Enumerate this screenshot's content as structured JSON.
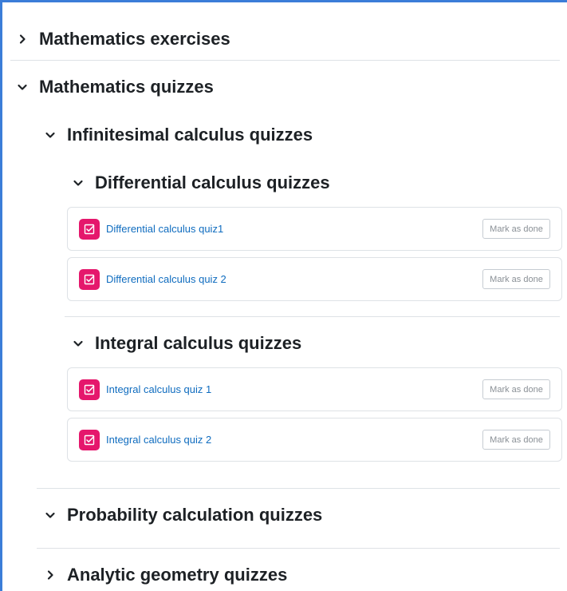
{
  "sections": {
    "math_exercises": {
      "title": "Mathematics exercises",
      "expanded": false
    },
    "math_quizzes": {
      "title": "Mathematics quizzes",
      "expanded": true
    },
    "infinitesimal": {
      "title": "Infinitesimal calculus quizzes",
      "expanded": true
    },
    "differential": {
      "title": "Differential calculus quizzes",
      "expanded": true
    },
    "integral": {
      "title": "Integral calculus quizzes",
      "expanded": true
    },
    "probability": {
      "title": "Probability calculation quizzes",
      "expanded": true
    },
    "analytic": {
      "title": "Analytic geometry quizzes",
      "expanded": false
    }
  },
  "activities": [
    {
      "name": "Differential calculus quiz1",
      "button": "Mark as done",
      "icon": "quiz-icon"
    },
    {
      "name": "Differential calculus quiz 2",
      "button": "Mark as done",
      "icon": "quiz-icon"
    },
    {
      "name": "Integral calculus quiz 1",
      "button": "Mark as done",
      "icon": "quiz-icon"
    },
    {
      "name": "Integral calculus quiz 2",
      "button": "Mark as done",
      "icon": "quiz-icon"
    }
  ],
  "colors": {
    "accent_border": "#3b7dd8",
    "quiz_icon_bg": "#e5176c",
    "link": "#0f6cbf",
    "heading": "#1d2125",
    "separator": "#dee2e6"
  }
}
